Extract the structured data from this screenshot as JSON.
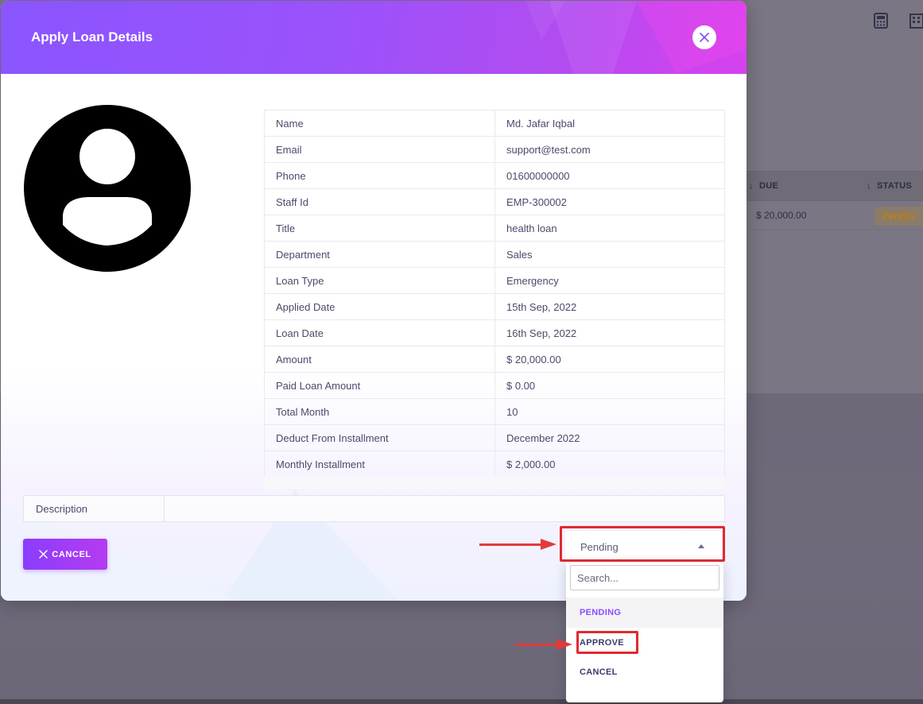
{
  "background": {
    "table_headers": {
      "due": "DUE",
      "status": "STATUS"
    },
    "row": {
      "due": "$ 20,000.00",
      "status": "Pendin"
    },
    "toolbar_icons": [
      "calculator-icon",
      "building-icon"
    ]
  },
  "modal": {
    "title": "Apply Loan Details",
    "details": [
      {
        "key": "Name",
        "value": "Md. Jafar Iqbal"
      },
      {
        "key": "Email",
        "value": "support@test.com"
      },
      {
        "key": "Phone",
        "value": "01600000000"
      },
      {
        "key": "Staff Id",
        "value": "EMP-300002"
      },
      {
        "key": "Title",
        "value": "health loan"
      },
      {
        "key": "Department",
        "value": "Sales"
      },
      {
        "key": "Loan Type",
        "value": "Emergency"
      },
      {
        "key": "Applied Date",
        "value": "15th Sep, 2022"
      },
      {
        "key": "Loan Date",
        "value": "16th Sep, 2022"
      },
      {
        "key": "Amount",
        "value": "$ 20,000.00"
      },
      {
        "key": "Paid Loan Amount",
        "value": "$ 0.00"
      },
      {
        "key": "Total Month",
        "value": "10"
      },
      {
        "key": "Deduct From Installment",
        "value": "December 2022"
      },
      {
        "key": "Monthly Installment",
        "value": "$ 2,000.00"
      }
    ],
    "description_label": "Description",
    "description_value": "",
    "cancel_label": "CANCEL",
    "status_select": {
      "value": "Pending",
      "search_placeholder": "Search...",
      "options": [
        "PENDING",
        "APPROVE",
        "CANCEL"
      ],
      "selected": "PENDING"
    }
  },
  "colors": {
    "accent": "#8a4dfd",
    "header_gradient_start": "#8a55ff",
    "header_gradient_end": "#d741ef",
    "annotation_red": "#e02a30"
  }
}
